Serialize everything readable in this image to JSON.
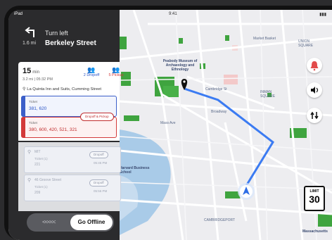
{
  "status": {
    "carrier": "iPad",
    "time": "9:41"
  },
  "nav": {
    "instruction": "Turn left",
    "distance": "1.6 mi",
    "street": "Berkeley Street"
  },
  "trip": {
    "minutes": "15",
    "minutes_unit": "min",
    "meta": "3.2 mi  |  05:32 PM",
    "dropoff": "2 Dropoff",
    "pickup": "5 Pickup",
    "address": "La Quinta Inn and Suits, Cumming Street",
    "ticket1": {
      "label": "Ticket",
      "numbers": "381, 620"
    },
    "ticket2": {
      "label": "Ticket",
      "numbers": "380, 600, 420, 521, 321"
    },
    "chip": "Dropoff & Pickup"
  },
  "stops": [
    {
      "address": "MIT",
      "ticket_label": "Ticket (1)",
      "number": "221",
      "chip": "Dropoff",
      "time": "05:45 PM"
    },
    {
      "address": "46 Groove Street",
      "ticket_label": "Ticket (1)",
      "number": "209",
      "chip": "Dropoff",
      "time": "05:56 PM"
    }
  ],
  "offline": {
    "label": "Go Offline",
    "arrows": "<<<<<"
  },
  "limit": {
    "label": "LIMIT",
    "value": "30"
  },
  "map_labels": {
    "market": "Market Basket",
    "union": "UNION SQUARE",
    "museum": "Peabody Museum of Archaeology and Ethnology",
    "cambridge_st": "Cambridge St",
    "inman": "INMAN SQUARE",
    "broadway": "Broadway",
    "mass_ave": "Mass Ave",
    "school": "Harvard Business School",
    "cambridgeport": "CAMBRIDGEPORT",
    "mit": "Massachusetts"
  },
  "colors": {
    "route": "#3b7bf2",
    "park": "#3fa43f",
    "water": "#a9cbe8",
    "dropoff": "#2b55c7",
    "pickup": "#d33a3a"
  }
}
